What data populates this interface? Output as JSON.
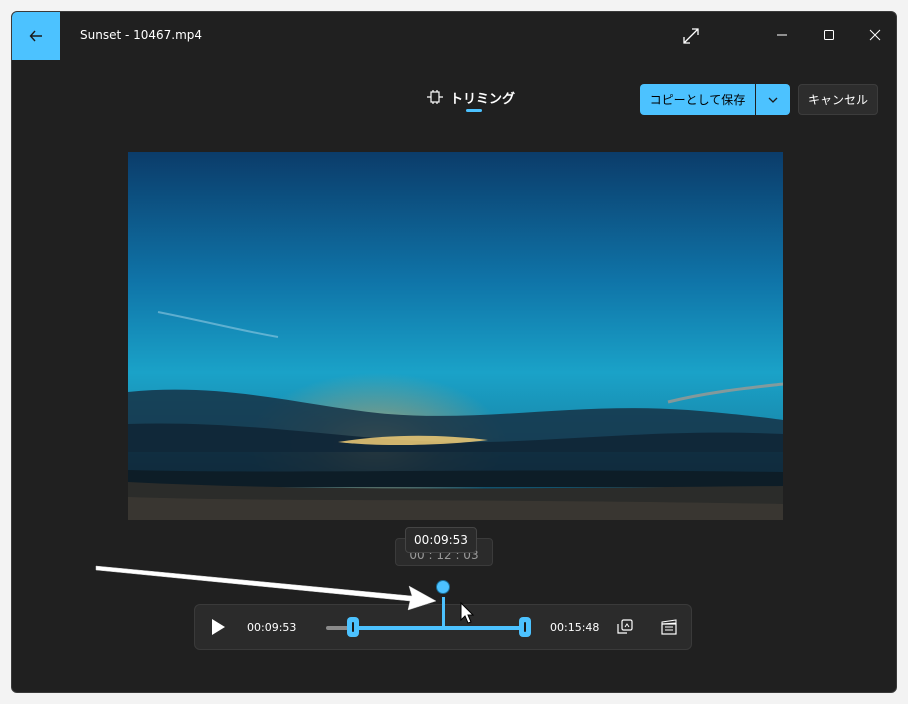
{
  "window": {
    "title": "Sunset - 10467.mp4",
    "icons": [
      "back-arrow-icon",
      "fullscreen-icon",
      "minimize-icon",
      "maximize-icon",
      "close-icon"
    ]
  },
  "toolbar": {
    "tab_label": "トリミング",
    "tab_icon": "trim-icon",
    "save_label": "コピーとして保存",
    "cancel_label": "キャンセル"
  },
  "timeline": {
    "tooltip_time": "00:09:53",
    "hidden_time": "00 : 12 : 03",
    "current_time": "00:09:53",
    "end_time": "00:15:48",
    "trim_start_fraction": 0.14,
    "playhead_fraction": 0.6,
    "trim_end_fraction": 1.0
  },
  "colors": {
    "accent": "#4cc2ff",
    "window_bg": "#202020",
    "panel_bg": "#2b2b2b"
  }
}
